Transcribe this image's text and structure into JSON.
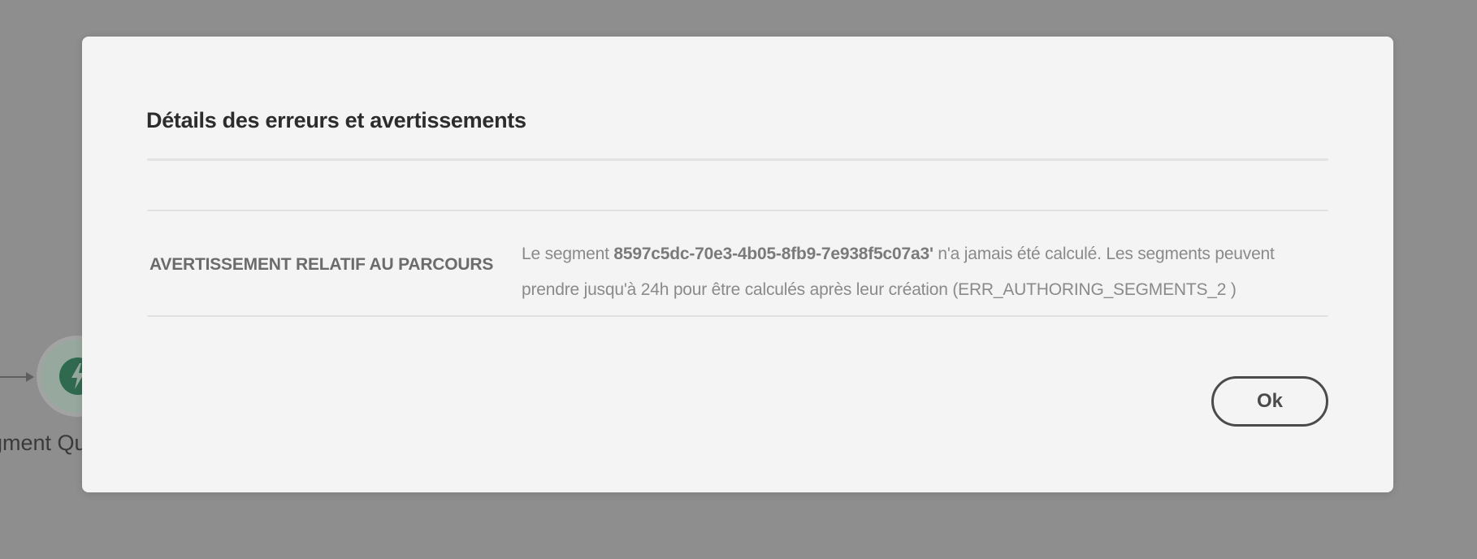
{
  "canvas": {
    "node_label": "gment Qu"
  },
  "modal": {
    "title": "Détails des erreurs et avertissements",
    "rows": [
      {
        "type": "AVERTISSEMENT RELATIF AU PARCOURS",
        "message_prefix": "Le segment ",
        "segment_id": "8597c5dc-70e3-4b05-8fb9-7e938f5c07a3'",
        "message_suffix": " n'a jamais été calculé. Les segments peuvent prendre jusqu'à 24h pour être calculés après leur création  (ERR_AUTHORING_SEGMENTS_2 )"
      }
    ],
    "ok_label": "Ok"
  }
}
